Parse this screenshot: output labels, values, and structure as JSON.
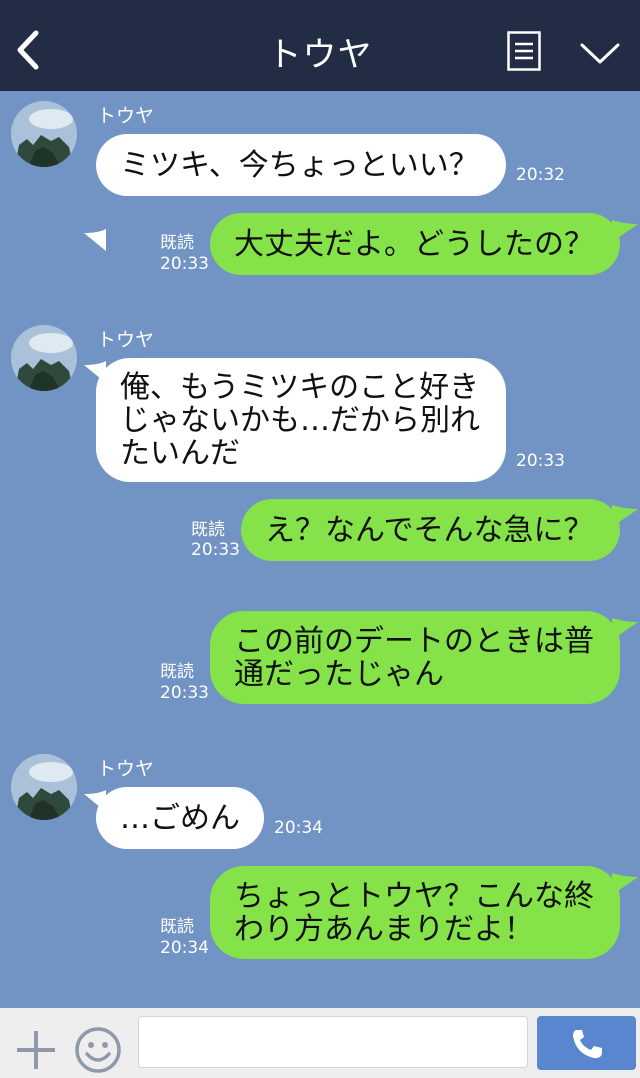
{
  "header": {
    "title": "トウヤ",
    "back_icon": "chevron-left-icon",
    "menu_icon": "list-icon",
    "collapse_icon": "chevron-down-icon"
  },
  "messages": [
    {
      "direction": "in",
      "sender": "トウヤ",
      "text": "ミツキ、今ちょっといい？",
      "time": "20:32"
    },
    {
      "direction": "out",
      "read": "既読",
      "text": "大丈夫だよ。どうしたの？",
      "time": "20:33"
    },
    {
      "direction": "in",
      "sender": "トウヤ",
      "text": "俺、もうミツキのこと好き\nじゃないかも…だから別れ\nたいんだ",
      "time": "20:33"
    },
    {
      "direction": "out",
      "read": "既読",
      "text": "え？なんでそんな急に？",
      "time": "20:33"
    },
    {
      "direction": "out",
      "read": "既読",
      "text": "この前のデートのときは普\n通だったじゃん",
      "time": "20:33"
    },
    {
      "direction": "in",
      "sender": "トウヤ",
      "text": "…ごめん",
      "time": "20:34"
    },
    {
      "direction": "out",
      "read": "既読",
      "text": "ちょっとトウヤ？こんな終\nわり方あんまりだよ！",
      "time": "20:34"
    }
  ],
  "footer": {
    "plus_icon": "plus-icon",
    "emoji_icon": "smiley-icon",
    "input_value": "",
    "call_icon": "phone-icon"
  },
  "colors": {
    "header_bg": "#232c45",
    "chat_bg": "#7194c4",
    "incoming_bubble": "#ffffff",
    "outgoing_bubble": "#85e249",
    "call_button": "#5a86cf"
  }
}
